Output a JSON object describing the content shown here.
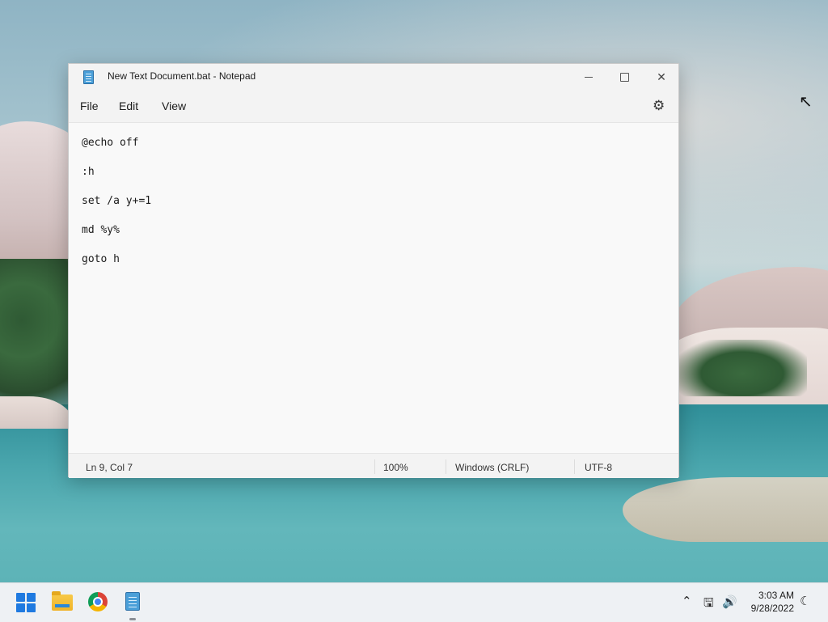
{
  "window": {
    "title": "New Text Document.bat - Notepad",
    "minimize_glyph": "—",
    "maximize_glyph": "☐",
    "close_glyph": "✕"
  },
  "menu": {
    "items": [
      {
        "label": "File"
      },
      {
        "label": "Edit"
      },
      {
        "label": "View"
      }
    ],
    "settings_icon": "gear-icon"
  },
  "editor": {
    "lines": [
      "@echo off",
      ":h",
      "set /a y+=1",
      "md %y%",
      "goto h"
    ]
  },
  "statusbar": {
    "position": "Ln 9, Col 7",
    "zoom": "100%",
    "line_ending": "Windows (CRLF)",
    "encoding": "UTF-8"
  },
  "taskbar": {
    "apps": [
      {
        "name": "start-icon"
      },
      {
        "name": "file-explorer-icon"
      },
      {
        "name": "chrome-icon"
      },
      {
        "name": "notepad-icon",
        "active": true
      }
    ],
    "tray": {
      "time": "3:03 AM",
      "date": "9/28/2022"
    }
  },
  "colors": {
    "accent": "#1f7ae0",
    "window_bg": "#f9f9f9",
    "titlebar_bg": "#f3f3f3"
  }
}
